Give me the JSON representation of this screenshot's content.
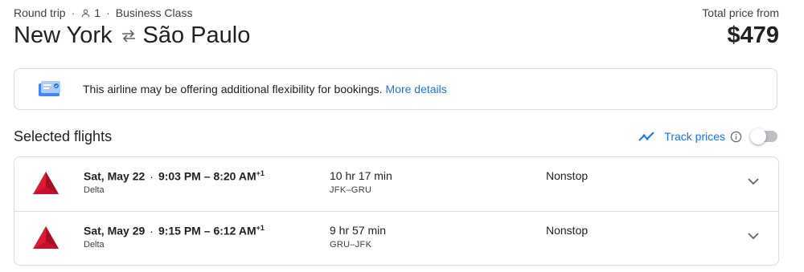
{
  "header": {
    "trip_type": "Round trip",
    "passengers": "1",
    "cabin_class": "Business Class",
    "origin": "New York",
    "destination": "São Paulo",
    "total_label": "Total price from",
    "total_price": "$479"
  },
  "notice": {
    "text": "This airline may be offering additional flexibility for bookings.",
    "link": "More details",
    "icon": "flexible-ticket-icon"
  },
  "selected": {
    "title": "Selected flights",
    "track_label": "Track prices",
    "track_enabled": false
  },
  "flights": [
    {
      "date": "Sat, May 22",
      "depart": "9:03 PM",
      "arrive": "8:20 AM",
      "day_offset": "+1",
      "airline": "Delta",
      "duration": "10 hr 17 min",
      "route": "JFK–GRU",
      "stops": "Nonstop"
    },
    {
      "date": "Sat, May 29",
      "depart": "9:15 PM",
      "arrive": "6:12 AM",
      "day_offset": "+1",
      "airline": "Delta",
      "duration": "9 hr 57 min",
      "route": "GRU–JFK",
      "stops": "Nonstop"
    }
  ],
  "colors": {
    "accent": "#1a73e8",
    "delta_red": "#c8102e",
    "border": "#dadce0"
  }
}
